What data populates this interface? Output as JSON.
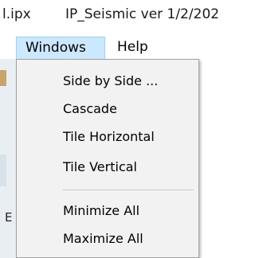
{
  "window": {
    "file_fragment": "l.ipx",
    "app_title": "IP_Seismic ver 1/2/202"
  },
  "menubar": {
    "windows_label": "Windows",
    "help_label": "Help"
  },
  "windows_menu": {
    "items": [
      {
        "label": "Side by Side ..."
      },
      {
        "label": "Cascade"
      },
      {
        "label": "Tile Horizontal"
      },
      {
        "label": "Tile Vertical"
      },
      {
        "label": "Minimize All"
      },
      {
        "label": "Maximize All"
      }
    ]
  },
  "background": {
    "left_fragment": "E"
  },
  "colors": {
    "menu_highlight": "#cce8ff",
    "menu_highlight_border": "#99d1ff",
    "dropdown_bg": "#f2f2f2",
    "dropdown_border": "#a0a0a0",
    "separator": "#c8c8c8"
  }
}
